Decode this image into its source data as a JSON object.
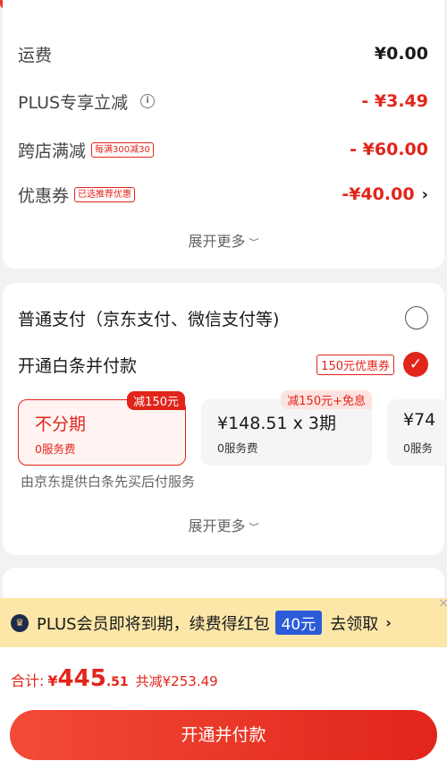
{
  "top_badge": "",
  "fees": [
    {
      "label": "运费",
      "amount": "¥0.00",
      "red": false
    },
    {
      "label": "PLUS专享立减",
      "amount": "- ¥3.49",
      "red": true,
      "info": true
    },
    {
      "label": "跨店满减",
      "tag": "每满300减30",
      "amount": "- ¥60.00",
      "red": true
    },
    {
      "label": "优惠券",
      "tag": "已选推荐优惠",
      "amount": "-¥40.00",
      "red": true,
      "chevron": "›"
    }
  ],
  "fees_expand": "展开更多",
  "payment": {
    "normal_label": "普通支付（京东支付、微信支付等)",
    "baitiao_label": "开通白条并付款",
    "baitiao_coupon": "150元优惠券",
    "plans": [
      {
        "title": "不分期",
        "sub": "0服务费",
        "badge": "减150元",
        "selected": true
      },
      {
        "title": "¥148.51 x 3期",
        "sub": "0服务费",
        "badge": "减150元+免息",
        "selected": false
      },
      {
        "title": "¥74",
        "sub": "0服务",
        "selected": false
      }
    ],
    "provider_text": "由京东提供白条先买后付服务",
    "expand": "展开更多"
  },
  "banner": {
    "text": "PLUS会员即将到期，续费得红包",
    "amount": "40元",
    "action": "去领取",
    "chevron": "›"
  },
  "summary": {
    "total_label": "合计:",
    "currency": "¥",
    "total_int": "445",
    "total_dec": ".51",
    "saved": "共减¥253.49"
  },
  "pay_button": "开通并付款",
  "colors": {
    "accent": "#e1251b",
    "banner_bg": "#fce7a9",
    "banner_pill": "#2b5bd7"
  }
}
